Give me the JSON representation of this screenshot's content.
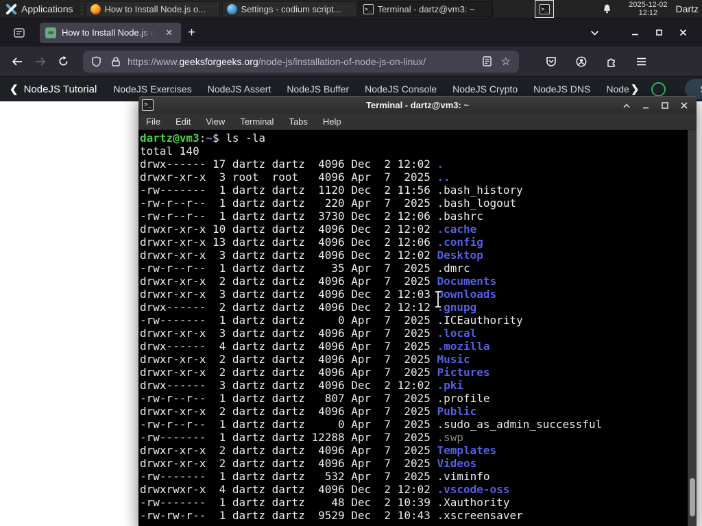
{
  "colors": {
    "prompt-green": "#47d147",
    "dir-blue": "#5560e6",
    "terminal-fg": "#ececec",
    "dim-file": "#8a8a8a",
    "gfg-green": "#2ebd62"
  },
  "panel": {
    "applications_label": "Applications",
    "windows": [
      {
        "title": "How to Install Node.js o...",
        "icon": "firefox"
      },
      {
        "title": "Settings - codium script...",
        "icon": "codium"
      },
      {
        "title": "Terminal - dartz@vm3: ~",
        "icon": "terminal"
      }
    ],
    "clock_date": "2025-12-02",
    "clock_time": "12:12",
    "user": "Dartz"
  },
  "browser": {
    "tab_title": "How to Install Node.js on",
    "url_scheme": "https://www.",
    "url_domain": "geeksforgeeks.org",
    "url_path": "/node-js/installation-of-node-js-on-linux/",
    "favicon_glyph": "∞",
    "star_glyph": "☆"
  },
  "site_nav": {
    "back_chevron": "❮",
    "back_item": "NodeJS Tutorial",
    "items": [
      "NodeJS Exercises",
      "NodeJS Assert",
      "NodeJS Buffer",
      "NodeJS Console",
      "NodeJS Crypto",
      "NodeJS DNS",
      "Node"
    ],
    "more_chevron": "❯",
    "sign_in": "Sign In"
  },
  "terminal": {
    "title": "Terminal - dartz@vm3: ~",
    "icon_glyph": ">_",
    "menu": [
      "File",
      "Edit",
      "View",
      "Terminal",
      "Tabs",
      "Help"
    ],
    "prompt_user": "dartz@vm3",
    "prompt_colon": ":",
    "prompt_path": "~",
    "prompt_cmd": "$ ls -la",
    "total_line": "total 140",
    "listing": [
      {
        "pre": "drwx------ 17 dartz dartz  4096 Dec  2 12:02 ",
        "name": ".",
        "type": "dir"
      },
      {
        "pre": "drwxr-xr-x  3 root  root   4096 Apr  7  2025 ",
        "name": "..",
        "type": "dir"
      },
      {
        "pre": "-rw-------  1 dartz dartz  1120 Dec  2 11:56 ",
        "name": ".bash_history",
        "type": "file"
      },
      {
        "pre": "-rw-r--r--  1 dartz dartz   220 Apr  7  2025 ",
        "name": ".bash_logout",
        "type": "file"
      },
      {
        "pre": "-rw-r--r--  1 dartz dartz  3730 Dec  2 12:06 ",
        "name": ".bashrc",
        "type": "file"
      },
      {
        "pre": "drwxr-xr-x 10 dartz dartz  4096 Dec  2 12:02 ",
        "name": ".cache",
        "type": "dir"
      },
      {
        "pre": "drwxr-xr-x 13 dartz dartz  4096 Dec  2 12:06 ",
        "name": ".config",
        "type": "dir"
      },
      {
        "pre": "drwxr-xr-x  3 dartz dartz  4096 Dec  2 12:02 ",
        "name": "Desktop",
        "type": "dir"
      },
      {
        "pre": "-rw-r--r--  1 dartz dartz    35 Apr  7  2025 ",
        "name": ".dmrc",
        "type": "file"
      },
      {
        "pre": "drwxr-xr-x  2 dartz dartz  4096 Apr  7  2025 ",
        "name": "Documents",
        "type": "dir"
      },
      {
        "pre": "drwxr-xr-x  3 dartz dartz  4096 Dec  2 12:03 ",
        "name": "Downloads",
        "type": "dir"
      },
      {
        "pre": "drwx------  2 dartz dartz  4096 Dec  2 12:12 ",
        "name": ".gnupg",
        "type": "dir"
      },
      {
        "pre": "-rw-------  1 dartz dartz     0 Apr  7  2025 ",
        "name": ".ICEauthority",
        "type": "file"
      },
      {
        "pre": "drwxr-xr-x  3 dartz dartz  4096 Apr  7  2025 ",
        "name": ".local",
        "type": "dir"
      },
      {
        "pre": "drwx------  4 dartz dartz  4096 Apr  7  2025 ",
        "name": ".mozilla",
        "type": "dir"
      },
      {
        "pre": "drwxr-xr-x  2 dartz dartz  4096 Apr  7  2025 ",
        "name": "Music",
        "type": "dir"
      },
      {
        "pre": "drwxr-xr-x  2 dartz dartz  4096 Apr  7  2025 ",
        "name": "Pictures",
        "type": "dir"
      },
      {
        "pre": "drwx------  3 dartz dartz  4096 Dec  2 12:02 ",
        "name": ".pki",
        "type": "dir"
      },
      {
        "pre": "-rw-r--r--  1 dartz dartz   807 Apr  7  2025 ",
        "name": ".profile",
        "type": "file"
      },
      {
        "pre": "drwxr-xr-x  2 dartz dartz  4096 Apr  7  2025 ",
        "name": "Public",
        "type": "dir"
      },
      {
        "pre": "-rw-r--r--  1 dartz dartz     0 Apr  7  2025 ",
        "name": ".sudo_as_admin_successful",
        "type": "file"
      },
      {
        "pre": "-rw-------  1 dartz dartz 12288 Apr  7  2025 ",
        "name": ".swp",
        "type": "dim"
      },
      {
        "pre": "drwxr-xr-x  2 dartz dartz  4096 Apr  7  2025 ",
        "name": "Templates",
        "type": "dir"
      },
      {
        "pre": "drwxr-xr-x  2 dartz dartz  4096 Apr  7  2025 ",
        "name": "Videos",
        "type": "dir"
      },
      {
        "pre": "-rw-------  1 dartz dartz   532 Apr  7  2025 ",
        "name": ".viminfo",
        "type": "file"
      },
      {
        "pre": "drwxrwxr-x  4 dartz dartz  4096 Dec  2 12:02 ",
        "name": ".vscode-oss",
        "type": "dir"
      },
      {
        "pre": "-rw-------  1 dartz dartz    48 Dec  2 10:39 ",
        "name": ".Xauthority",
        "type": "file"
      },
      {
        "pre": "-rw-rw-r--  1 dartz dartz  9529 Dec  2 10:43 ",
        "name": ".xscreensaver",
        "type": "file"
      }
    ]
  }
}
